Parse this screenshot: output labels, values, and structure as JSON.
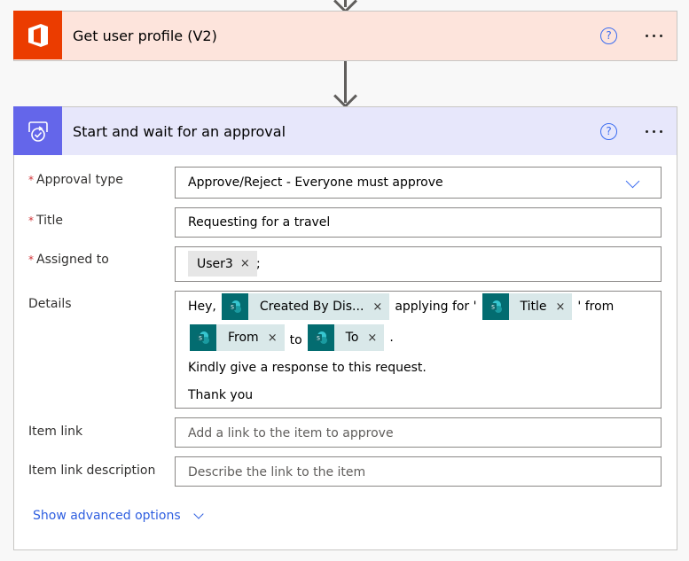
{
  "steps": [
    {
      "title": "Get user profile (V2)",
      "icon": "office-icon",
      "accent": "#eb3c00",
      "header_bg": "#fde4dc"
    },
    {
      "title": "Start and wait for an approval",
      "icon": "approval-icon",
      "accent": "#6466ea",
      "header_bg": "#e7e7fb",
      "fields": {
        "approval_type": {
          "label": "Approval type",
          "required": true,
          "value": "Approve/Reject - Everyone must approve"
        },
        "title": {
          "label": "Title",
          "required": true,
          "value": "Requesting for a travel"
        },
        "assigned_to": {
          "label": "Assigned to",
          "required": true,
          "token": "User3",
          "suffix": ";"
        },
        "details": {
          "label": "Details",
          "line1": {
            "t1": "Hey,",
            "tok1": "Created By Dis...",
            "t2": "applying for '",
            "tok2": "Title",
            "t3": "' from"
          },
          "line2": {
            "tok3": "From",
            "t4": "to",
            "tok4": "To",
            "t5": "."
          },
          "line3": "Kindly give a response to this request.",
          "line4": "Thank you"
        },
        "item_link": {
          "label": "Item link",
          "placeholder": "Add a link to the item to approve"
        },
        "item_link_description": {
          "label": "Item link description",
          "placeholder": "Describe the link to the item"
        }
      },
      "advanced_label": "Show advanced options"
    }
  ],
  "common": {
    "required_mark": "*",
    "remove_mark": "×",
    "help_mark": "?"
  }
}
